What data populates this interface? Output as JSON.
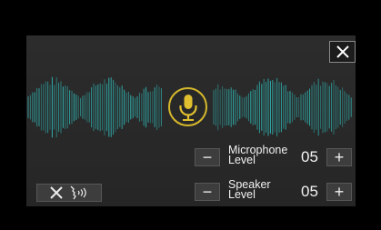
{
  "controls": {
    "microphone": {
      "label": "Microphone\nLevel",
      "value": "05",
      "minus": "−",
      "plus": "+"
    },
    "speaker": {
      "label": "Speaker\nLevel",
      "value": "05",
      "minus": "−",
      "plus": "+"
    }
  },
  "icons": {
    "close": "close-icon",
    "microphone": "microphone-icon",
    "mute": "x-icon",
    "voice": "speaking-head-icon"
  },
  "colors": {
    "accent": "#d6b82b",
    "wave": "#2fb8b5",
    "panel": "#2b2b2b"
  }
}
